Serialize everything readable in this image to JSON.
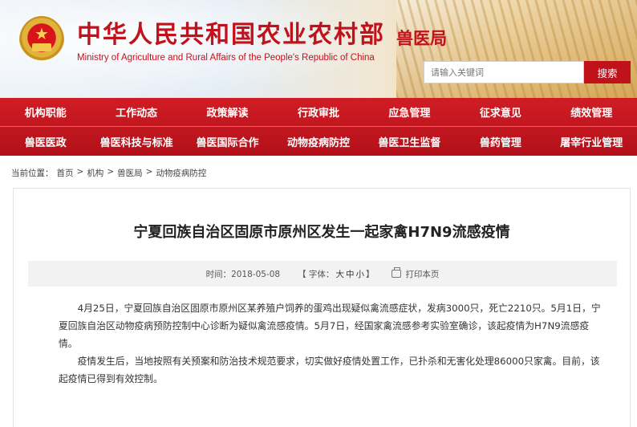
{
  "header": {
    "title_cn": "中华人民共和国农业农村部",
    "title_en": "Ministry of Agriculture and Rural Affairs of the People's Republic of China",
    "bureau": "兽医局",
    "search": {
      "placeholder": "请输入关键词",
      "button_label": "搜索"
    }
  },
  "nav": {
    "row1": [
      "机构职能",
      "工作动态",
      "政策解读",
      "行政审批",
      "应急管理",
      "征求意见",
      "绩效管理"
    ],
    "row2": [
      "兽医医政",
      "兽医科技与标准",
      "兽医国际合作",
      "动物疫病防控",
      "兽医卫生监督",
      "兽药管理",
      "屠宰行业管理"
    ]
  },
  "breadcrumb": {
    "prefix": "当前位置：",
    "items": [
      "首页",
      "机构",
      "兽医局",
      "动物疫病防控"
    ],
    "separator": ">"
  },
  "article": {
    "title": "宁夏回族自治区固原市原州区发生一起家禽H7N9流感疫情",
    "time_label": "时间：",
    "time": "2018-05-08",
    "font_label": "【 字体：",
    "font_sizes": [
      "大",
      "中",
      "小"
    ],
    "font_close": "】",
    "print_label": "打印本页",
    "paragraphs": [
      "4月25日，宁夏回族自治区固原市原州区某养殖户饲养的蛋鸡出现疑似禽流感症状，发病3000只，死亡2210只。5月1日，宁夏回族自治区动物疫病预防控制中心诊断为疑似禽流感疫情。5月7日，经国家禽流感参考实验室确诊，该起疫情为H7N9流感疫情。",
      "疫情发生后，当地按照有关预案和防治技术规范要求，切实做好疫情处置工作，已扑杀和无害化处理86000只家禽。目前，该起疫情已得到有效控制。"
    ]
  },
  "colors": {
    "brand_red": "#c1121c",
    "nav_red": "#c8161e",
    "meta_bg": "#f2f2f2"
  },
  "icons": {
    "emblem": "national-emblem-icon",
    "print": "printer-icon"
  }
}
